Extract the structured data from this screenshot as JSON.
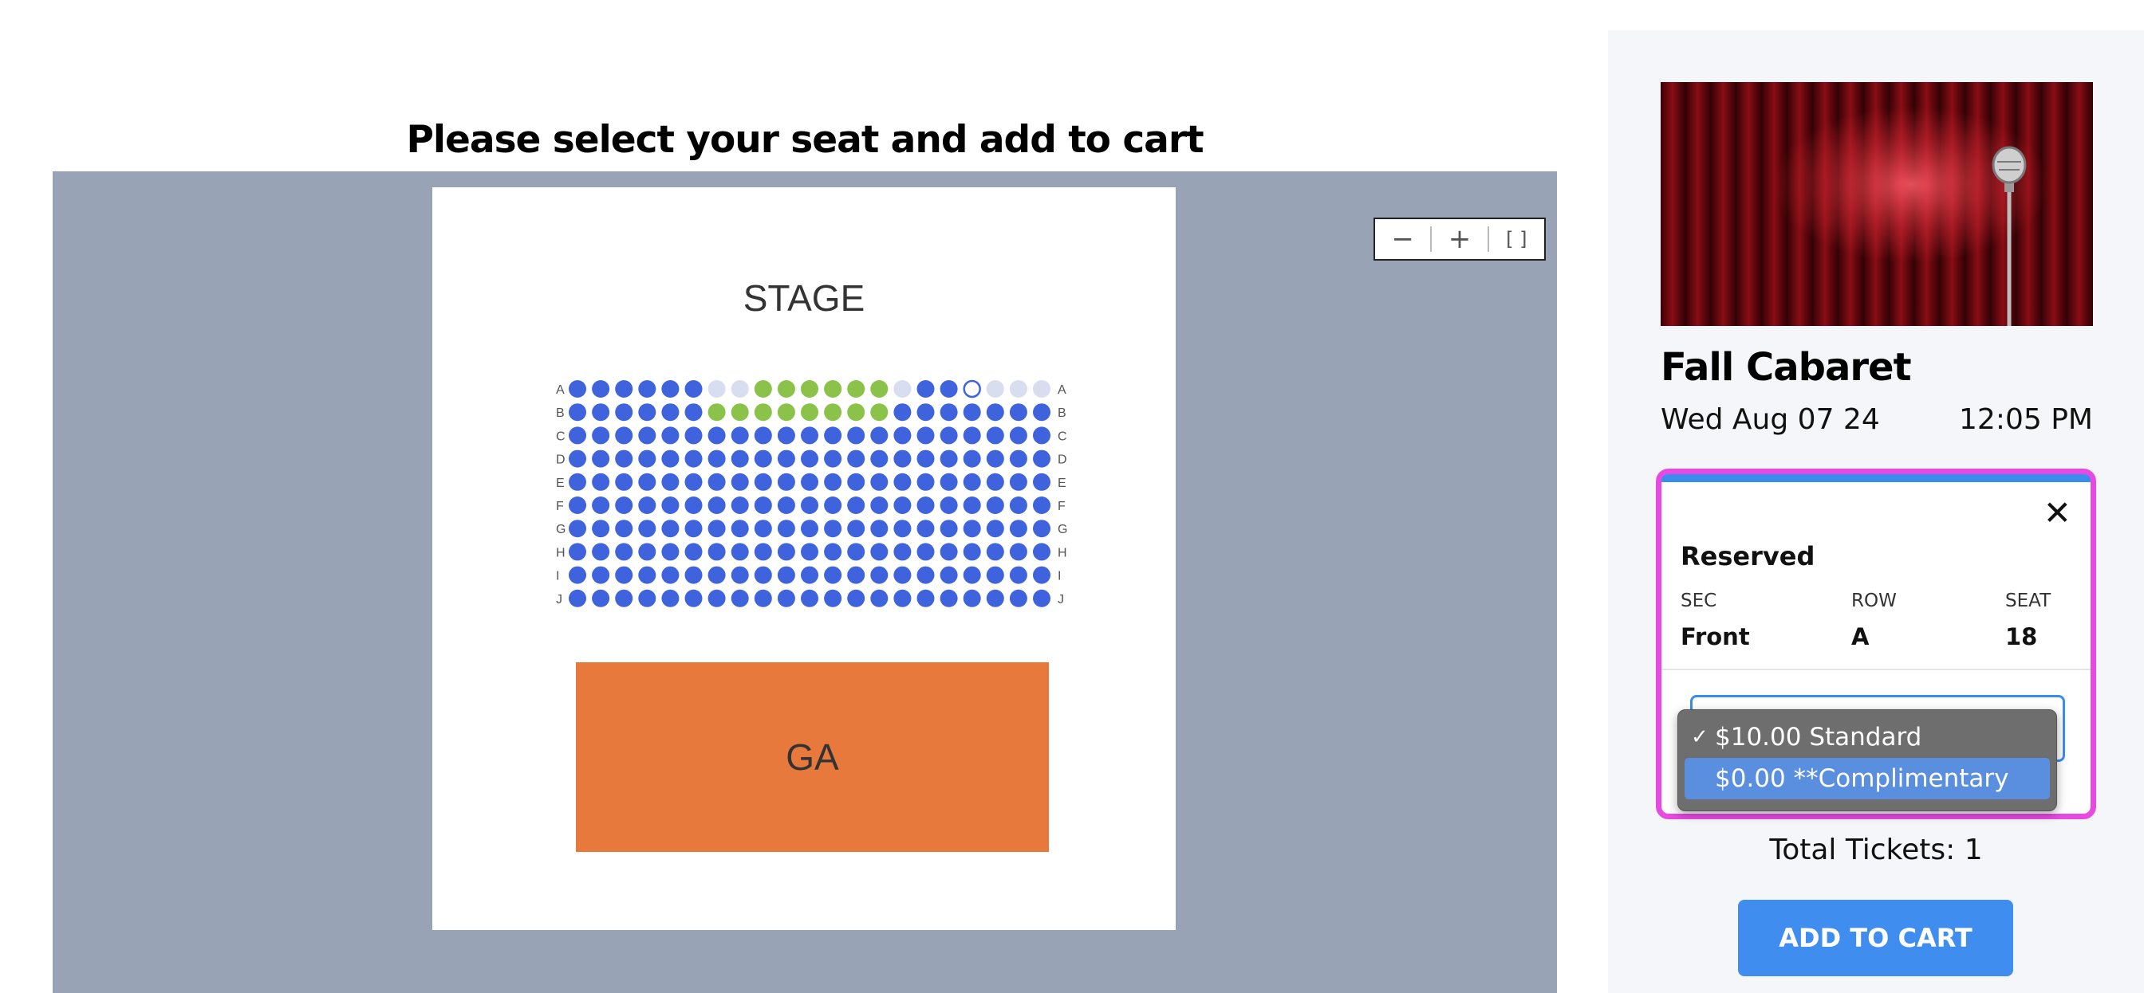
{
  "page": {
    "heading": "Please select your seat and add to cart"
  },
  "seat_map": {
    "stage_label": "STAGE",
    "ga_label": "GA",
    "rows": [
      "A",
      "B",
      "C",
      "D",
      "E",
      "F",
      "G",
      "H",
      "I",
      "J"
    ],
    "seats_per_row": 21,
    "colors": {
      "available": "#3f63dd",
      "special": "#8bc34a",
      "unavailable": "#d8ddef",
      "selected_stroke": "#3f63dd",
      "ga": "#e8793d",
      "background": "#99a3b6"
    },
    "special_seats": {
      "A": [
        9,
        10,
        11,
        12,
        13,
        14
      ],
      "B": [
        7,
        8,
        9,
        10,
        11,
        12,
        13,
        14
      ]
    },
    "unavailable_seats": {
      "A": [
        7,
        8,
        15,
        19,
        20,
        21
      ]
    },
    "selected_seat": {
      "row": "A",
      "seat": 18
    }
  },
  "zoom_controls": {
    "zoom_out": "−",
    "zoom_in": "+",
    "fit": "[ ]"
  },
  "event": {
    "title": "Fall Cabaret",
    "date": "Wed Aug 07 24",
    "time": "12:05 PM"
  },
  "ticket": {
    "close": "✕",
    "type": "Reserved",
    "sec_label": "SEC",
    "row_label": "ROW",
    "seat_label": "SEAT",
    "sec_value": "Front",
    "row_value": "A",
    "seat_value": "18",
    "price_options": [
      {
        "label": "$10.00 Standard",
        "checked": true
      },
      {
        "label": "$0.00 **Complimentary",
        "highlighted": true
      }
    ],
    "check_mark": "✓"
  },
  "cart": {
    "total_tickets": "Total Tickets: 1",
    "add_to_cart": "ADD TO CART"
  }
}
